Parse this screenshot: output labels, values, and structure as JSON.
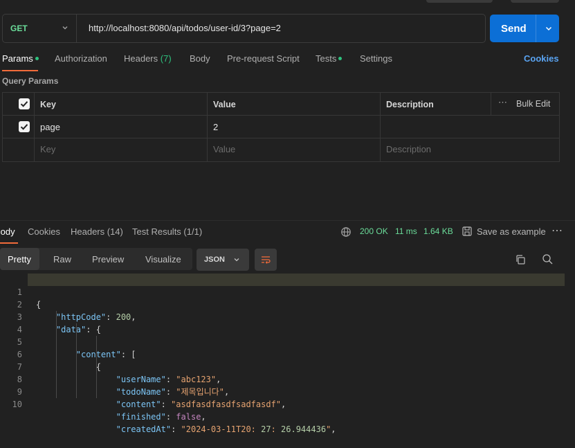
{
  "request": {
    "method": "GET",
    "url": "http://localhost:8080/api/todos/user-id/3?page=2",
    "send_label": "Send"
  },
  "request_tabs": {
    "params": "Params",
    "authorization": "Authorization",
    "headers": "Headers",
    "headers_count": "(7)",
    "body": "Body",
    "prerequest": "Pre-request Script",
    "tests": "Tests",
    "settings": "Settings",
    "cookies": "Cookies"
  },
  "query_params": {
    "title": "Query Params",
    "columns": {
      "key": "Key",
      "value": "Value",
      "description": "Description",
      "bulk_edit": "Bulk Edit"
    },
    "rows": [
      {
        "key": "page",
        "value": "2",
        "description": "",
        "checked": true
      }
    ],
    "placeholders": {
      "key": "Key",
      "value": "Value",
      "description": "Description"
    }
  },
  "response_tabs": {
    "body": "Body",
    "cookies": "Cookies",
    "headers": "Headers (14)",
    "test_results": "Test Results (1/1)"
  },
  "response_status": {
    "code": "200 OK",
    "time": "11 ms",
    "size": "1.64 KB",
    "save_example": "Save as example"
  },
  "response_view": {
    "modes": [
      "Pretty",
      "Raw",
      "Preview",
      "Visualize"
    ],
    "active_mode": "Pretty",
    "format": "JSON"
  },
  "code_lines": [
    {
      "n": "1",
      "text": "{"
    },
    {
      "n": "2",
      "text": "    \"httpCode\": 200,"
    },
    {
      "n": "3",
      "text": "    \"data\": {"
    },
    {
      "n": "4",
      "text": "        \"content\": ["
    },
    {
      "n": "5",
      "text": "            {"
    },
    {
      "n": "6",
      "text": "                \"userName\": \"abc123\","
    },
    {
      "n": "7",
      "text": "                \"todoName\": \"제목입니다\","
    },
    {
      "n": "8",
      "text": "                \"content\": \"asdfasdfasdfsadfasdf\","
    },
    {
      "n": "9",
      "text": "                \"finished\": false,"
    },
    {
      "n": "10",
      "text": "                \"createdAt\": \"2024-03-11T20:27:26.944436\","
    }
  ],
  "icons": {
    "status_globe": "globe-icon",
    "save": "save-icon",
    "more": "more-horizontal-icon",
    "copy": "copy-icon",
    "search": "search-icon",
    "wrap": "wrap-lines-icon"
  },
  "colors": {
    "accent_send": "#0c6fd6",
    "success": "#2ec27e",
    "tab_underline": "#f26b3a",
    "link": "#5aa4f2"
  }
}
